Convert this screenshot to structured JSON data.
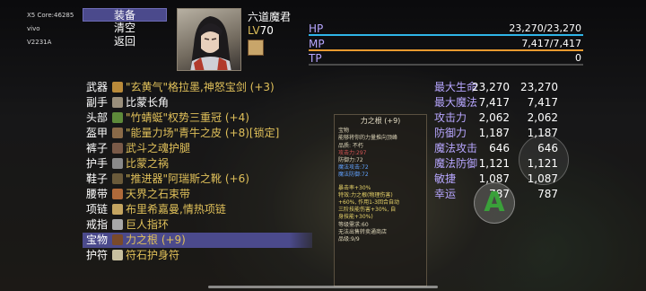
{
  "sysinfo": [
    "X5 Core:46285",
    "vivo",
    "V2231A"
  ],
  "menu": [
    {
      "label": "装备"
    },
    {
      "label": "清空"
    },
    {
      "label": "返回"
    }
  ],
  "character": {
    "name": "六道魔君",
    "lv_label": "LV",
    "lv_value": "70"
  },
  "stats": [
    {
      "key": "HP",
      "value": "23,270/23,270",
      "color": "#2fb5e8"
    },
    {
      "key": "MP",
      "value": "7,417/7,417",
      "color": "#e89a2f"
    },
    {
      "key": "TP",
      "value": "0",
      "color": "#7b7b7b"
    }
  ],
  "equipment": [
    {
      "slot": "武器",
      "name": "\"玄黄气\"格拉墨,神怒宝剑 (+3)",
      "icon_color": "#b98a3a"
    },
    {
      "slot": "副手",
      "name": "比蒙长角",
      "icon_color": "#9a8f7c"
    },
    {
      "slot": "头部",
      "name": "\"竹蜻蜓\"权势三重冠 (+4)",
      "icon_color": "#5e8a3a"
    },
    {
      "slot": "盔甲",
      "name": "\"能量力场\"青牛之皮 (+8)[锁定]",
      "icon_color": "#8a6a48"
    },
    {
      "slot": "裤子",
      "name": "武斗之魂护腿",
      "icon_color": "#7a5a48"
    },
    {
      "slot": "护手",
      "name": "比蒙之祸",
      "icon_color": "#8a8a8a"
    },
    {
      "slot": "鞋子",
      "name": "\"推进器\"阿瑞斯之靴 (+6)",
      "icon_color": "#6a5a3a"
    },
    {
      "slot": "腰带",
      "name": "天界之石束带",
      "icon_color": "#b06a3a"
    },
    {
      "slot": "项链",
      "name": "布里希嘉曼,情热项链",
      "icon_color": "#c4a460"
    },
    {
      "slot": "戒指",
      "name": "巨人指环",
      "icon_color": "#a8a8a8"
    },
    {
      "slot": "宝物",
      "name": "力之根 (+9)",
      "icon_color": "#7a4a2a"
    },
    {
      "slot": "护符",
      "name": "符石护身符",
      "icon_color": "#c8c0a0"
    }
  ],
  "attributes": [
    {
      "key": "最大生命",
      "current": "23,270",
      "new": "23,270"
    },
    {
      "key": "最大魔法",
      "current": "7,417",
      "new": "7,417"
    },
    {
      "key": "攻击力",
      "current": "2,062",
      "new": "2,062"
    },
    {
      "key": "防御力",
      "current": "1,187",
      "new": "1,187"
    },
    {
      "key": "魔法攻击",
      "current": "646",
      "new": "646"
    },
    {
      "key": "魔法防御",
      "current": "1,121",
      "new": "1,121"
    },
    {
      "key": "敏捷",
      "current": "1,087",
      "new": "1,087"
    },
    {
      "key": "幸运",
      "current": "787",
      "new": "787"
    }
  ],
  "tooltip": {
    "title": "力之根 (+9)",
    "lines": [
      {
        "text": "宝物",
        "cls": ""
      },
      {
        "text": "能够将你的力量推向顶峰",
        "cls": ""
      },
      {
        "text": "品质: 不朽",
        "cls": ""
      },
      {
        "text": "攻击力:297",
        "cls": "red"
      },
      {
        "text": "防御力:72",
        "cls": ""
      },
      {
        "text": "魔法攻击:72",
        "cls": "blue"
      },
      {
        "text": "魔法防御:72",
        "cls": "blue"
      },
      {
        "text": "",
        "cls": ""
      },
      {
        "text": "暴击率+30%",
        "cls": "yel"
      },
      {
        "text": "特效:力之根(物理伤害)",
        "cls": ""
      },
      {
        "text": "+60%, 作用1-3回合自动",
        "cls": ""
      },
      {
        "text": "三阶技能伤害+30%, 自",
        "cls": ""
      },
      {
        "text": "身技能+30%)",
        "cls": ""
      },
      {
        "text": "等级需求:60",
        "cls": ""
      },
      {
        "text": "无法出售转卖通商店",
        "cls": ""
      },
      {
        "text": "品级:9/9",
        "cls": ""
      }
    ]
  },
  "action_button": {
    "label": "A"
  }
}
